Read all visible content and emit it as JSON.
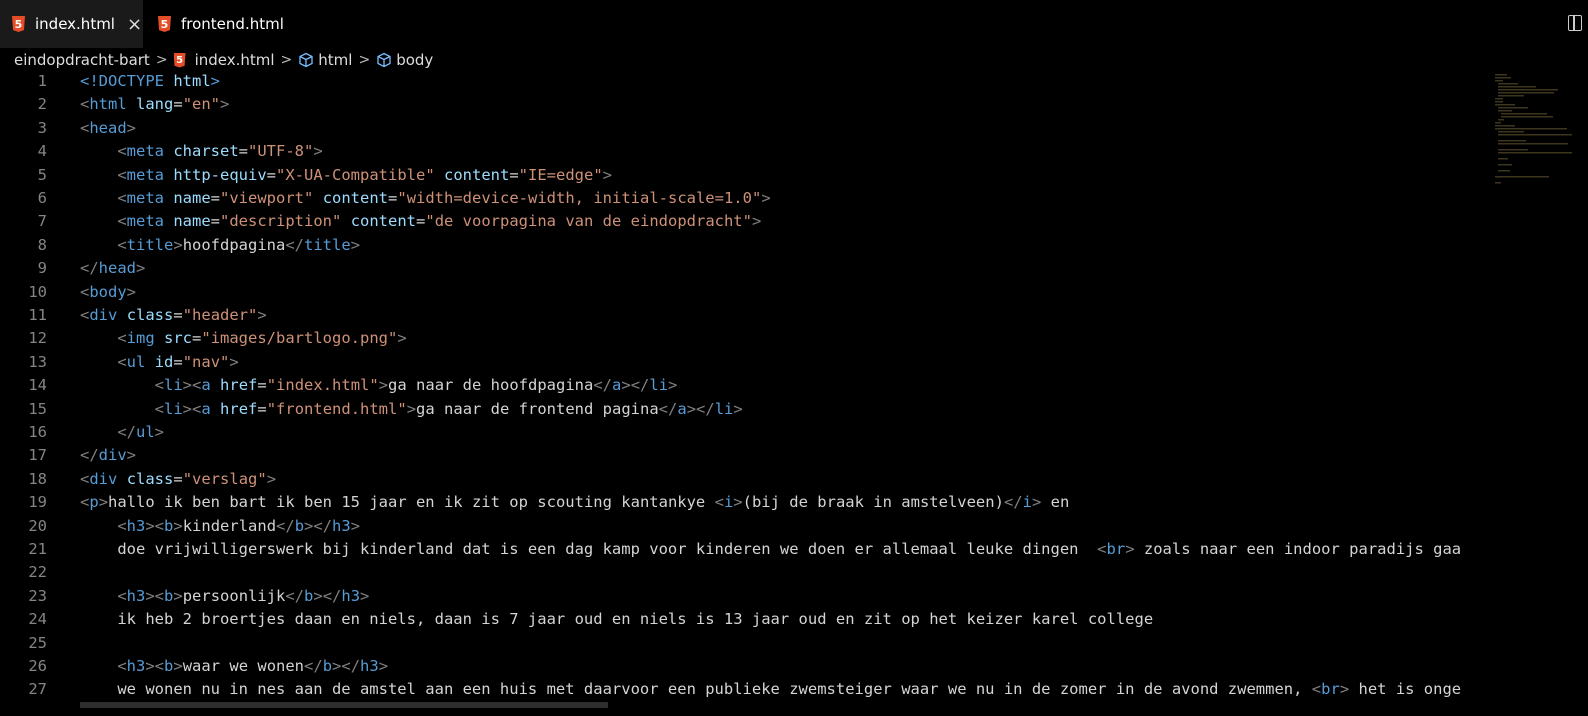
{
  "tabs": [
    {
      "label": "index.html",
      "icon": "html5-icon",
      "active": true,
      "close": "×"
    },
    {
      "label": "frontend.html",
      "icon": "html5-icon",
      "active": false
    }
  ],
  "breadcrumb": [
    "eindopdracht-bart",
    "index.html",
    "html",
    "body"
  ],
  "code": {
    "lines": [
      {
        "n": "1",
        "html": "<span class='t-tag'>&lt;!DOCTYPE</span> <span class='t-attr'>html</span><span class='t-tag'>&gt;</span>"
      },
      {
        "n": "2",
        "html": "<span class='t-b'>&lt;</span><span class='t-tag'>html</span> <span class='t-attr'>lang</span>=<span class='t-str'>\"en\"</span><span class='t-b'>&gt;</span>"
      },
      {
        "n": "3",
        "html": "<span class='t-b'>&lt;</span><span class='t-tag'>head</span><span class='t-b'>&gt;</span>"
      },
      {
        "n": "4",
        "html": "    <span class='t-b'>&lt;</span><span class='t-tag'>meta</span> <span class='t-attr'>charset</span>=<span class='t-str'>\"UTF-8\"</span><span class='t-b'>&gt;</span>"
      },
      {
        "n": "5",
        "html": "    <span class='t-b'>&lt;</span><span class='t-tag'>meta</span> <span class='t-attr'>http-equiv</span>=<span class='t-str'>\"X-UA-Compatible\"</span> <span class='t-attr'>content</span>=<span class='t-str'>\"IE=edge\"</span><span class='t-b'>&gt;</span>"
      },
      {
        "n": "6",
        "html": "    <span class='t-b'>&lt;</span><span class='t-tag'>meta</span> <span class='t-attr'>name</span>=<span class='t-str'>\"viewport\"</span> <span class='t-attr'>content</span>=<span class='t-str'>\"width=device-width, initial-scale=1.0\"</span><span class='t-b'>&gt;</span>"
      },
      {
        "n": "7",
        "html": "    <span class='t-b'>&lt;</span><span class='t-tag'>meta</span> <span class='t-attr'>name</span>=<span class='t-str'>\"description\"</span> <span class='t-attr'>content</span>=<span class='t-str'>\"de voorpagina van de eindopdracht\"</span><span class='t-b'>&gt;</span>"
      },
      {
        "n": "8",
        "html": "    <span class='t-b'>&lt;</span><span class='t-tag'>title</span><span class='t-b'>&gt;</span>hoofdpagina<span class='t-b'>&lt;/</span><span class='t-tag'>title</span><span class='t-b'>&gt;</span>"
      },
      {
        "n": "9",
        "html": "<span class='t-b'>&lt;/</span><span class='t-tag'>head</span><span class='t-b'>&gt;</span>"
      },
      {
        "n": "10",
        "html": "<span class='t-b'>&lt;</span><span class='t-tag'>body</span><span class='t-b'>&gt;</span>"
      },
      {
        "n": "11",
        "html": "<span class='t-b'>&lt;</span><span class='t-tag'>div</span> <span class='t-attr'>class</span>=<span class='t-str'>\"header\"</span><span class='t-b'>&gt;</span>"
      },
      {
        "n": "12",
        "html": "    <span class='t-b'>&lt;</span><span class='t-tag'>img</span> <span class='t-attr'>src</span>=<span class='t-str'>\"images/bartlogo.png\"</span><span class='t-b'>&gt;</span>"
      },
      {
        "n": "13",
        "html": "    <span class='t-b'>&lt;</span><span class='t-tag'>ul</span> <span class='t-attr'>id</span>=<span class='t-str'>\"nav\"</span><span class='t-b'>&gt;</span>"
      },
      {
        "n": "14",
        "html": "        <span class='t-b'>&lt;</span><span class='t-tag'>li</span><span class='t-b'>&gt;&lt;</span><span class='t-tag'>a</span> <span class='t-attr'>href</span>=<span class='t-str'>\"index.html\"</span><span class='t-b'>&gt;</span>ga naar de hoofdpagina<span class='t-b'>&lt;/</span><span class='t-tag'>a</span><span class='t-b'>&gt;&lt;/</span><span class='t-tag'>li</span><span class='t-b'>&gt;</span>"
      },
      {
        "n": "15",
        "html": "        <span class='t-b'>&lt;</span><span class='t-tag'>li</span><span class='t-b'>&gt;&lt;</span><span class='t-tag'>a</span> <span class='t-attr'>href</span>=<span class='t-str'>\"frontend.html\"</span><span class='t-b'>&gt;</span>ga naar de frontend pagina<span class='t-b'>&lt;/</span><span class='t-tag'>a</span><span class='t-b'>&gt;&lt;/</span><span class='t-tag'>li</span><span class='t-b'>&gt;</span>"
      },
      {
        "n": "16",
        "html": "    <span class='t-b'>&lt;/</span><span class='t-tag'>ul</span><span class='t-b'>&gt;</span>"
      },
      {
        "n": "17",
        "html": "<span class='t-b'>&lt;/</span><span class='t-tag'>div</span><span class='t-b'>&gt;</span>"
      },
      {
        "n": "18",
        "html": "<span class='t-b'>&lt;</span><span class='t-tag'>div</span> <span class='t-attr'>class</span>=<span class='t-str'>\"verslag\"</span><span class='t-b'>&gt;</span>"
      },
      {
        "n": "19",
        "html": "<span class='t-b'>&lt;</span><span class='t-tag'>p</span><span class='t-b'>&gt;</span>hallo ik ben bart ik ben 15 jaar en ik zit op scouting kantankye <span class='t-b'>&lt;</span><span class='t-tag'>i</span><span class='t-b'>&gt;</span>(bij de braak in amstelveen)<span class='t-b'>&lt;/</span><span class='t-tag'>i</span><span class='t-b'>&gt;</span> en"
      },
      {
        "n": "20",
        "html": "    <span class='t-b'>&lt;</span><span class='t-tag'>h3</span><span class='t-b'>&gt;&lt;</span><span class='t-tag'>b</span><span class='t-b'>&gt;</span>kinderland<span class='t-b'>&lt;/</span><span class='t-tag'>b</span><span class='t-b'>&gt;&lt;/</span><span class='t-tag'>h3</span><span class='t-b'>&gt;</span>"
      },
      {
        "n": "21",
        "html": "    doe vrijwilligerswerk bij kinderland dat is een dag kamp voor kinderen we doen er allemaal leuke dingen  <span class='t-b'>&lt;</span><span class='t-tag'>br</span><span class='t-b'>&gt;</span> zoals naar een indoor paradijs gaa"
      },
      {
        "n": "22",
        "html": ""
      },
      {
        "n": "23",
        "html": "    <span class='t-b'>&lt;</span><span class='t-tag'>h3</span><span class='t-b'>&gt;&lt;</span><span class='t-tag'>b</span><span class='t-b'>&gt;</span>persoonlijk<span class='t-b'>&lt;/</span><span class='t-tag'>b</span><span class='t-b'>&gt;&lt;/</span><span class='t-tag'>h3</span><span class='t-b'>&gt;</span>"
      },
      {
        "n": "24",
        "html": "    ik heb 2 broertjes daan en niels, daan is 7 jaar oud en niels is 13 jaar oud en zit op het keizer karel college"
      },
      {
        "n": "25",
        "html": ""
      },
      {
        "n": "26",
        "html": "    <span class='t-b'>&lt;</span><span class='t-tag'>h3</span><span class='t-b'>&gt;&lt;</span><span class='t-tag'>b</span><span class='t-b'>&gt;</span>waar we wonen<span class='t-b'>&lt;/</span><span class='t-tag'>b</span><span class='t-b'>&gt;&lt;/</span><span class='t-tag'>h3</span><span class='t-b'>&gt;</span>"
      },
      {
        "n": "27",
        "html": "    we wonen nu in nes aan de amstel aan een huis met daarvoor een publieke zwemsteiger waar we nu in de zomer in de avond zwemmen, <span class='t-b'>&lt;</span><span class='t-tag'>br</span><span class='t-b'>&gt;</span> het is onge"
      }
    ]
  },
  "colors": {
    "background": "#000000",
    "tag": "#569cd6",
    "attr": "#9cdcfe",
    "string": "#ce9178",
    "html5": "#e44d26"
  }
}
